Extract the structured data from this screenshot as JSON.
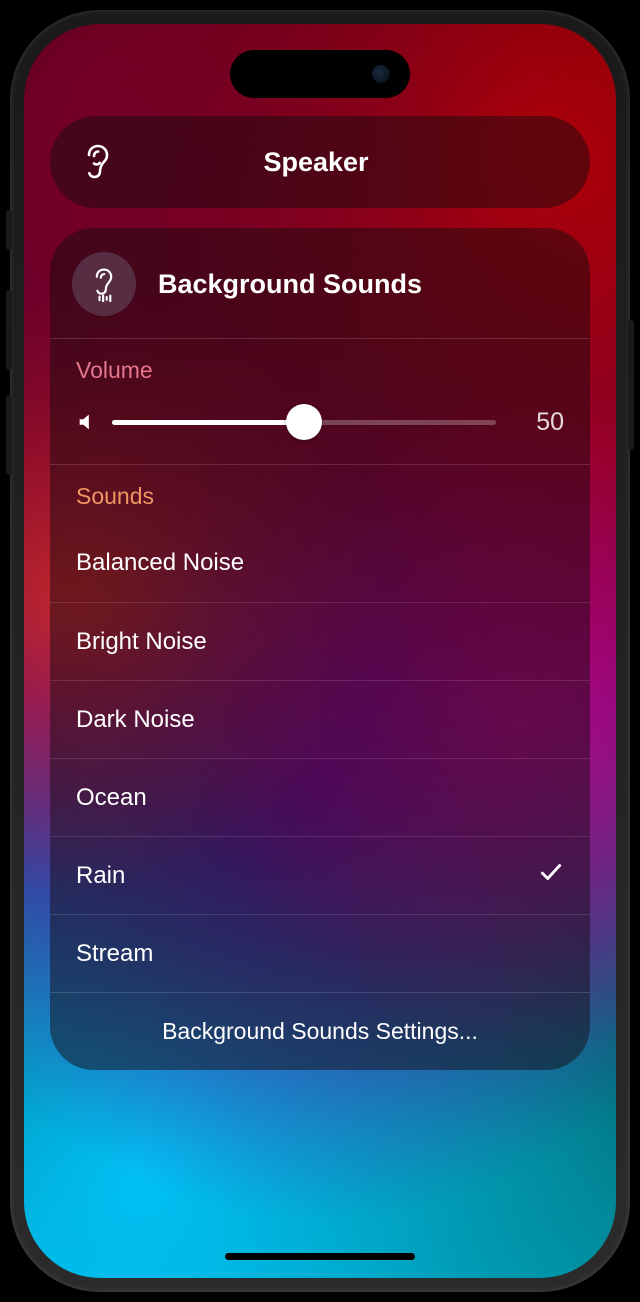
{
  "speaker": {
    "label": "Speaker"
  },
  "panel": {
    "title": "Background Sounds",
    "volume_label": "Volume",
    "volume_value": "50",
    "volume_percent": 50,
    "sounds_label": "Sounds",
    "sounds": [
      {
        "name": "Balanced Noise",
        "selected": false
      },
      {
        "name": "Bright Noise",
        "selected": false
      },
      {
        "name": "Dark Noise",
        "selected": false
      },
      {
        "name": "Ocean",
        "selected": false
      },
      {
        "name": "Rain",
        "selected": true
      },
      {
        "name": "Stream",
        "selected": false
      }
    ],
    "settings_label": "Background Sounds Settings..."
  }
}
